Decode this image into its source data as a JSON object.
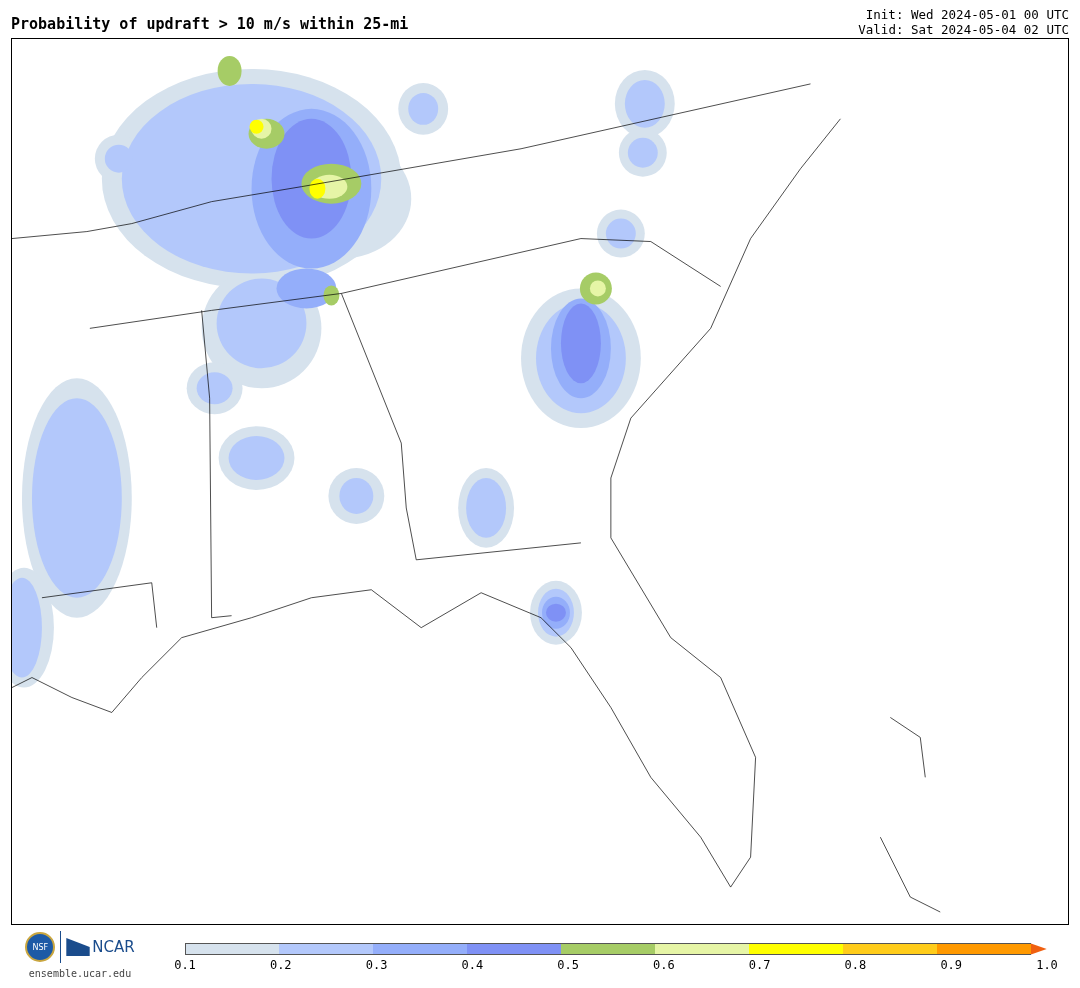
{
  "title": "Probability of updraft > 10 m/s within 25-mi",
  "init": "Init: Wed 2024-05-01 00 UTC",
  "valid": "Valid: Sat 2024-05-04 02 UTC",
  "logos": {
    "nsf": "NSF",
    "ncar": "NCAR",
    "site": "ensemble.ucar.edu"
  },
  "colorbar": {
    "bins": [
      {
        "kind": "swatch",
        "color": "#d6e2ed"
      },
      {
        "kind": "swatch",
        "color": "#b3c8fb"
      },
      {
        "kind": "swatch",
        "color": "#94aefa"
      },
      {
        "kind": "swatch",
        "color": "#7f91f5"
      },
      {
        "kind": "swatch",
        "color": "#a6cc66"
      },
      {
        "kind": "swatch",
        "color": "#e6f5a6"
      },
      {
        "kind": "swatch",
        "color": "#ffff00"
      },
      {
        "kind": "swatch",
        "color": "#ffcc1a"
      },
      {
        "kind": "swatch",
        "color": "#ff9900"
      },
      {
        "kind": "arrow",
        "color": "#f06010"
      }
    ],
    "ticks": [
      "0.1",
      "0.2",
      "0.3",
      "0.4",
      "0.5",
      "0.6",
      "0.7",
      "0.8",
      "0.9",
      "1.0"
    ]
  }
}
